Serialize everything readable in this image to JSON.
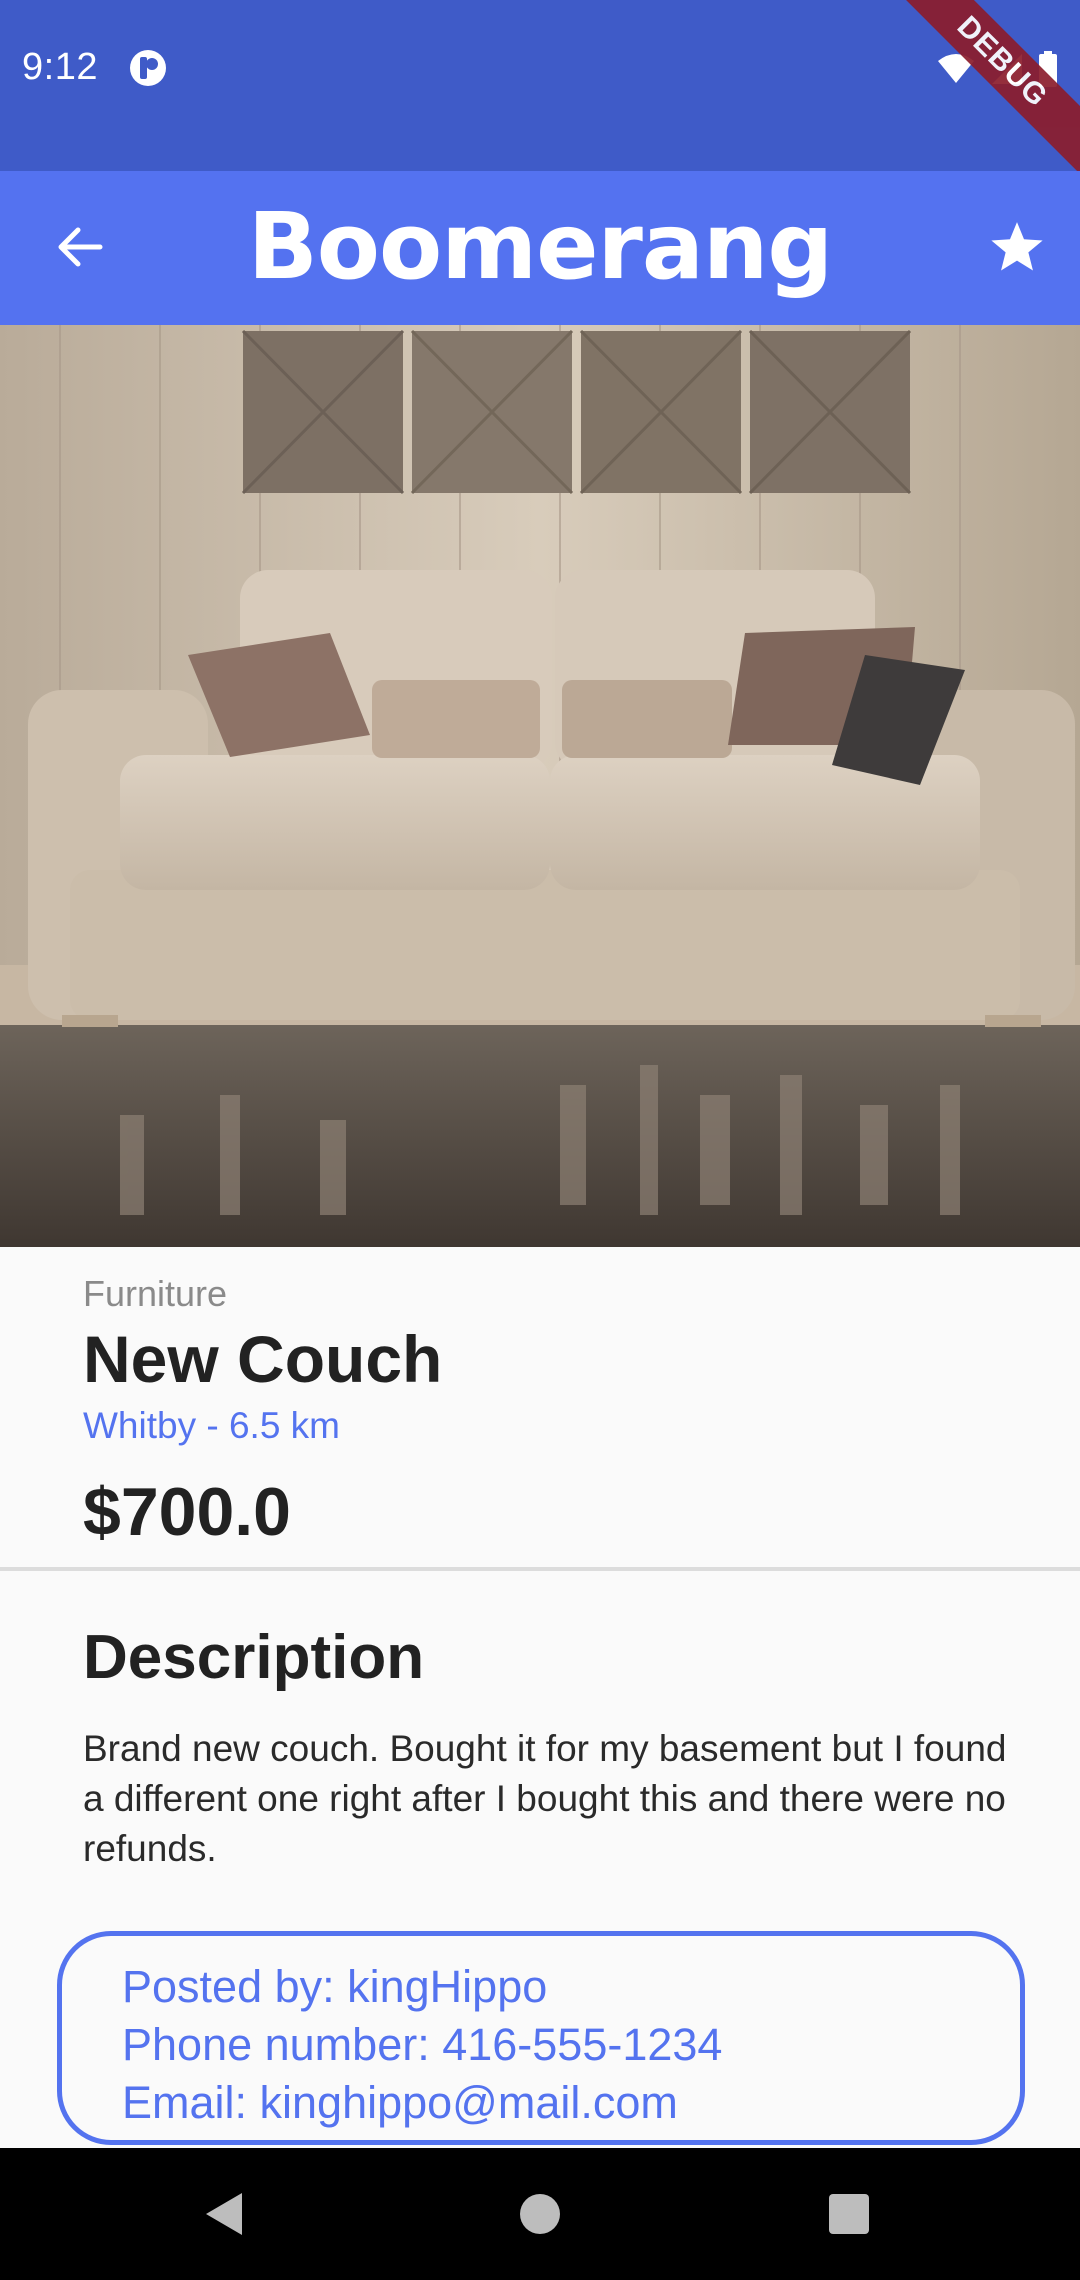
{
  "status_bar": {
    "time": "9:12",
    "debug_label": "DEBUG",
    "icons": [
      "app-notification-icon",
      "wifi-icon",
      "signal-icon",
      "battery-icon"
    ],
    "color": "#3f5bc8"
  },
  "app_bar": {
    "title": "Boomerang",
    "back_icon": "arrow-left-icon",
    "favorite_icon": "star-icon",
    "color": "#5472f0"
  },
  "listing": {
    "image": "couch-photo",
    "category": "Furniture",
    "title": "New Couch",
    "location": "Whitby - 6.5 km",
    "price": "$700.0"
  },
  "description": {
    "heading": "Description",
    "body": "Brand new couch. Bought it for my basement but I found a different one right after I bought this and there were no refunds."
  },
  "contact": {
    "posted_by": "Posted by: kingHippo",
    "phone": "Phone number: 416-555-1234",
    "email": "Email: kinghippo@mail.com",
    "accent": "#5473ef"
  },
  "nav_bar": {
    "icons": [
      "nav-back-icon",
      "nav-home-icon",
      "nav-recents-icon"
    ]
  }
}
